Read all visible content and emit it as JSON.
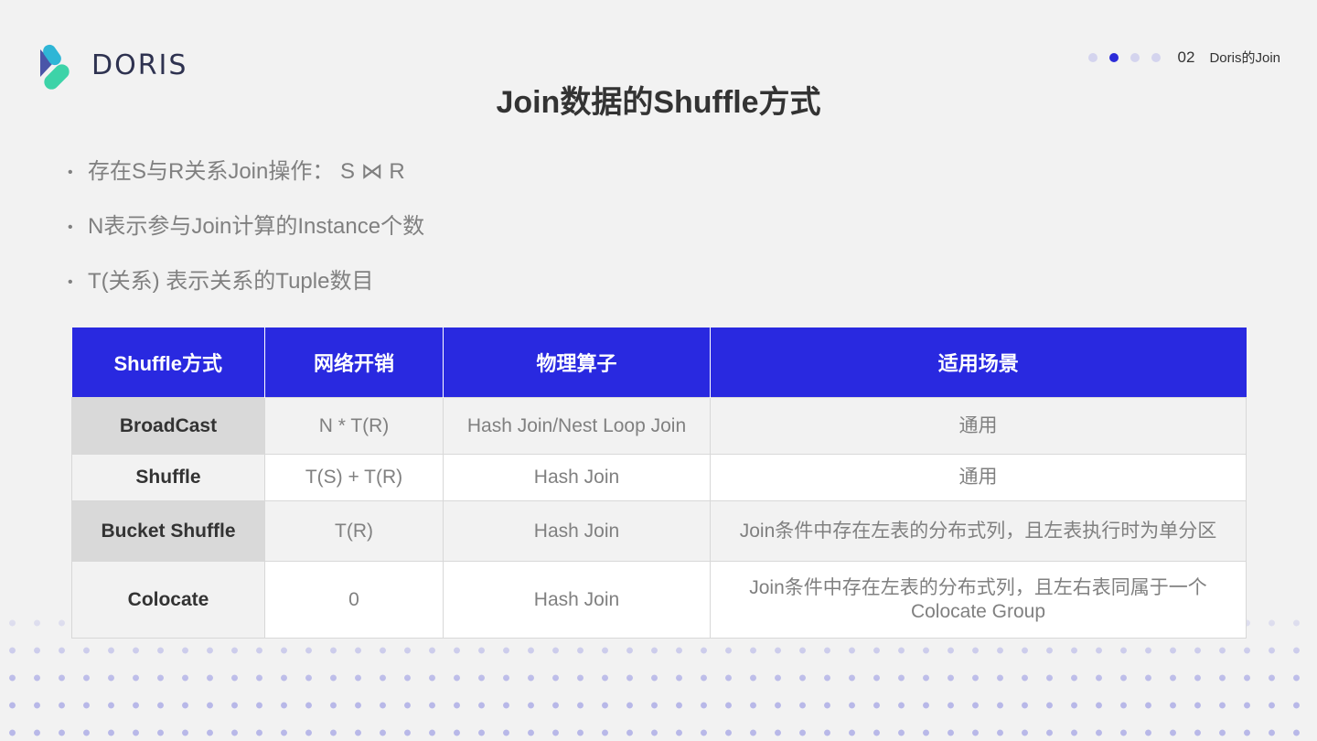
{
  "brand": {
    "logo_text": "DORIS",
    "colors": {
      "accent": "#2929e0",
      "logo_teal": "#3dd3a8",
      "logo_cyan": "#2fb6d6",
      "logo_blue": "#4a55a8"
    }
  },
  "header": {
    "page_number": "02",
    "section": "Doris的Join",
    "pager_dots": 4,
    "active_dot": 1
  },
  "title": "Join数据的Shuffle方式",
  "bullets": [
    "存在S与R关系Join操作： S ⋈ R",
    "N表示参与Join计算的Instance个数",
    "T(关系) 表示关系的Tuple数目"
  ],
  "table": {
    "headers": [
      "Shuffle方式",
      "网络开销",
      "物理算子",
      "适用场景"
    ],
    "rows": [
      [
        "BroadCast",
        "N * T(R)",
        "Hash Join/Nest Loop Join",
        "通用"
      ],
      [
        "Shuffle",
        "T(S) + T(R)",
        "Hash Join",
        "通用"
      ],
      [
        "Bucket Shuffle",
        "T(R)",
        "Hash Join",
        "Join条件中存在左表的分布式列，且左表执行时为单分区"
      ],
      [
        "Colocate",
        "0",
        "Hash Join",
        "Join条件中存在左表的分布式列，且左右表同属于一个Colocate Group"
      ]
    ]
  }
}
